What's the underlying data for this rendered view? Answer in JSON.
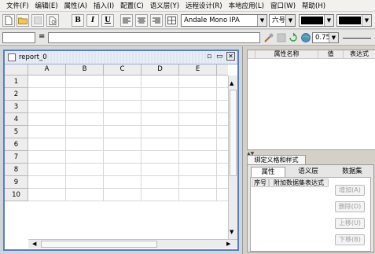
{
  "menu": [
    "文件(F)",
    "编辑(E)",
    "属性(A)",
    "插入(I)",
    "配置(C)",
    "语义层(Y)",
    "远程设计(R)",
    "本地应用(L)",
    "窗口(W)",
    "帮助(H)"
  ],
  "toolbar": {
    "new_icon": "new-document-icon",
    "open_icon": "open-folder-icon",
    "save_icon": "save-icon",
    "preview_icon": "print-preview-icon",
    "bold": "B",
    "italic": "I",
    "underline": "U",
    "font_name": "Andale Mono IPA",
    "font_size": "六号",
    "text_color": "#000000",
    "fill_color": "#000000"
  },
  "formula_bar": {
    "cell_ref": "",
    "equals": "=",
    "formula": "",
    "zoom": "0.75"
  },
  "report": {
    "title": "report_0",
    "columns": [
      "A",
      "B",
      "C",
      "D",
      "E"
    ],
    "rows": [
      "1",
      "2",
      "3",
      "4",
      "5",
      "6",
      "7",
      "8",
      "9",
      "10"
    ]
  },
  "properties_table": {
    "headers": [
      "属性名称",
      "值",
      "表达式"
    ]
  },
  "bottom_panel": {
    "tab_header": "绑定义格和样式",
    "tabs": [
      "属性",
      "语义层",
      "数据集"
    ],
    "list_headers": [
      "序号",
      "附加数据集表达式"
    ],
    "buttons": [
      "增加(A)",
      "删除(D)",
      "上移(U)",
      "下移(B)"
    ]
  }
}
